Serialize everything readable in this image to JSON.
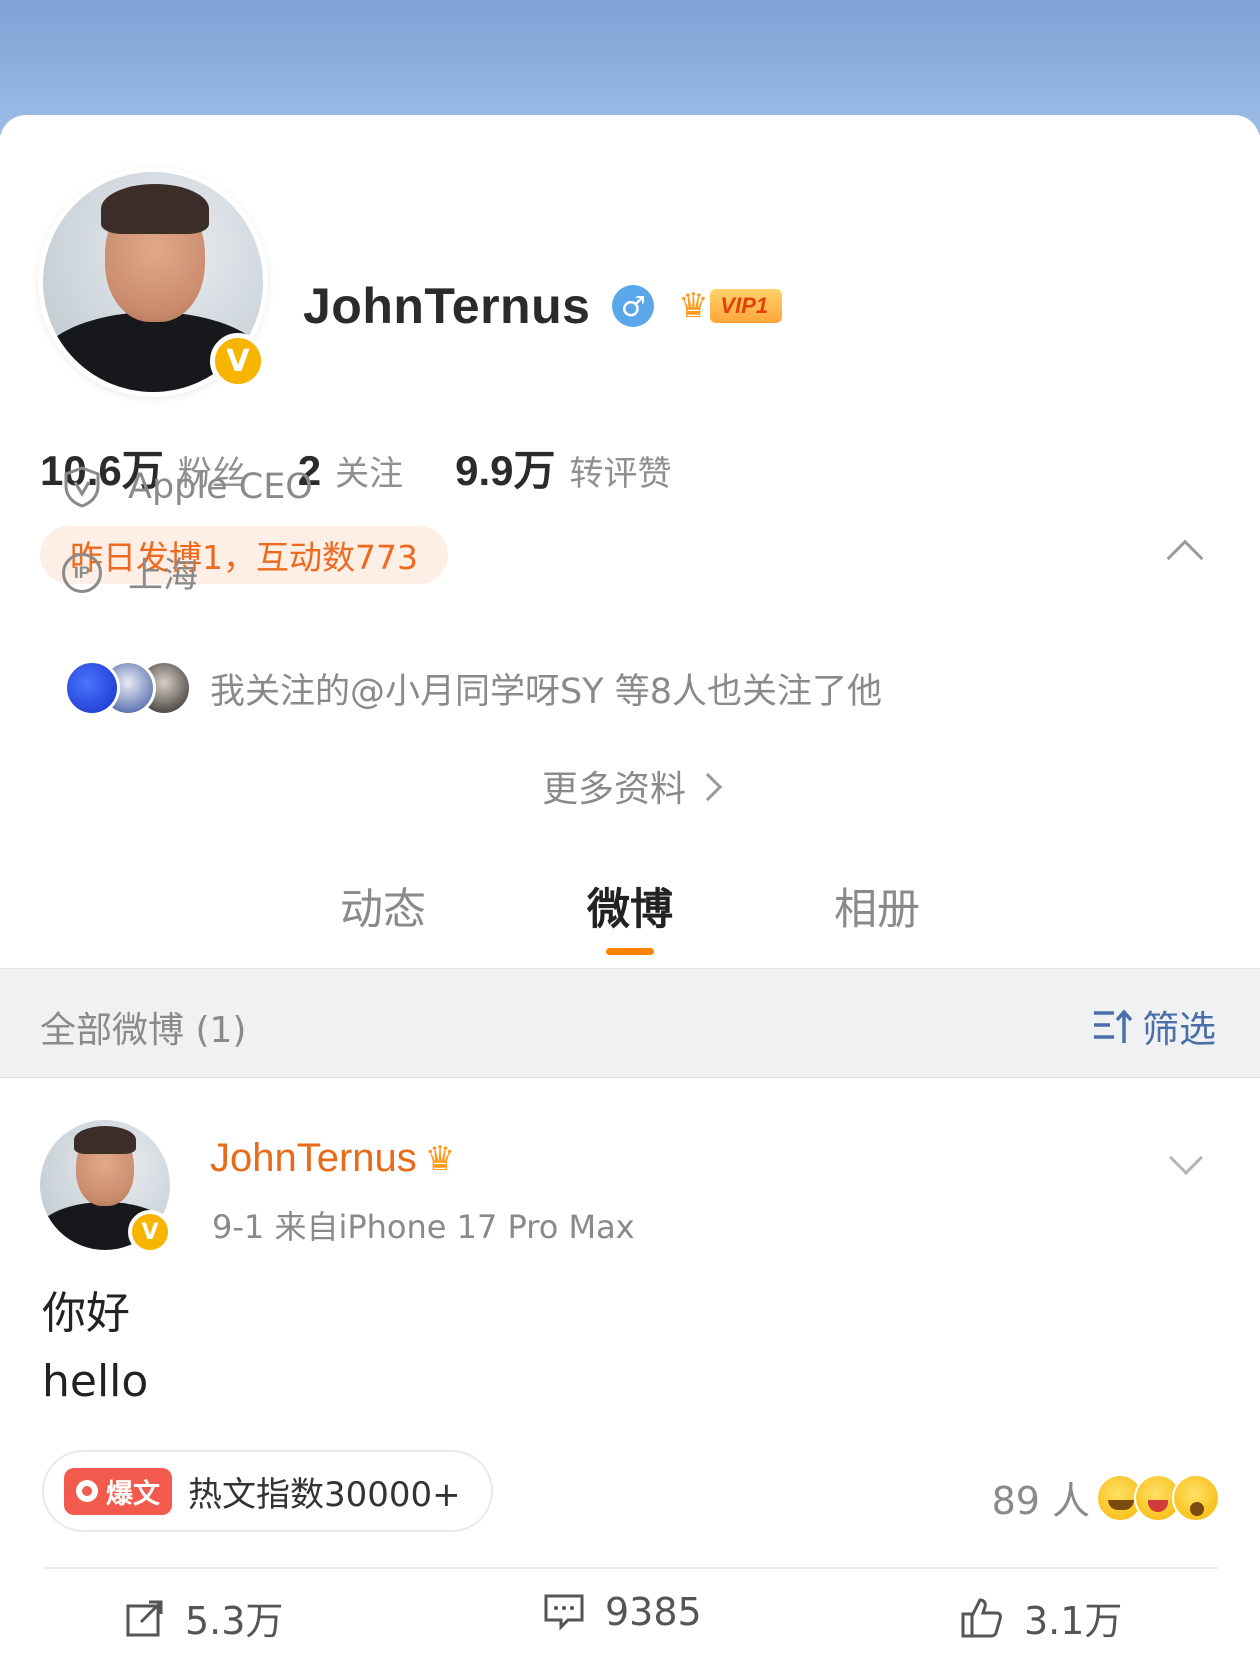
{
  "profile": {
    "username": "JohnTernus",
    "gender_symbol": "♂",
    "vip_label": "VIP1",
    "verified_symbol": "V",
    "stats": [
      {
        "num": "10.6万",
        "label": "粉丝"
      },
      {
        "num": "2",
        "label": "关注"
      },
      {
        "num": "9.9万",
        "label": "转评赞"
      }
    ],
    "activity_pill": "昨日发博1，互动数773",
    "title": "Apple CEO",
    "ip_badge": "IP",
    "ip_location": "上海",
    "mutual_follow": "我关注的@小月同学呀SY  等8人也关注了他",
    "more_info": "更多资料"
  },
  "tabs": [
    {
      "label": "动态"
    },
    {
      "label": "微博"
    },
    {
      "label": "相册"
    }
  ],
  "filter_bar": {
    "title": "全部微博 (1)",
    "filter_label": "筛选"
  },
  "post": {
    "author": "JohnTernus",
    "meta": "9-1  来自iPhone 17 Pro Max",
    "text_line1": "你好",
    "text_line2": "hello",
    "hot_tag": "爆文",
    "hot_text": "热文指数30000+",
    "reaction_count": "89 人",
    "repost_count": "5.3万",
    "comment_count": "9385",
    "like_count": "3.1万"
  },
  "colors": {
    "accent_orange": "#ff8200",
    "name_orange": "#e86b1c",
    "filter_blue": "#4a6fa8",
    "verified_gold": "#f7b500"
  }
}
